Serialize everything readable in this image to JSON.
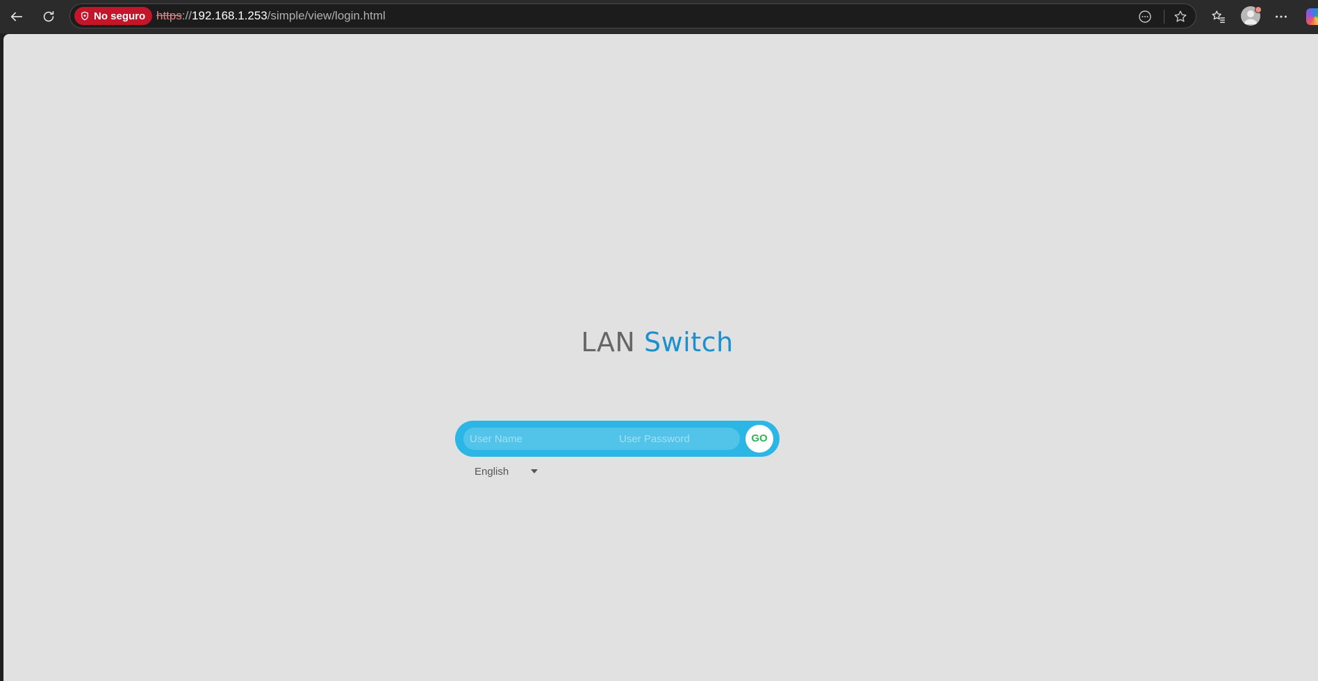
{
  "browser": {
    "security_label": "No seguro",
    "url": {
      "scheme": "https",
      "separator": "://",
      "host": "192.168.1.253",
      "path": "/simple/view/login.html"
    },
    "icons": {
      "back": "back-arrow-icon",
      "refresh": "refresh-icon",
      "security": "shield-warning-icon",
      "page_options": "more-circle-icon",
      "favorite": "star-icon",
      "favorites_list": "favorites-icon",
      "profile": "profile-avatar-icon",
      "menu": "ellipsis-icon",
      "copilot": "copilot-icon"
    },
    "colors": {
      "security_badge": "#c4152a",
      "toolbar": "#2b2b2b"
    }
  },
  "page": {
    "title_part1": "LAN",
    "title_part2": "Switch",
    "username_placeholder": "User Name",
    "password_placeholder": "User Password",
    "go_label": "GO",
    "language_selected": "English",
    "colors": {
      "background": "#e1e1e1",
      "login_box": "#2cb6e6",
      "title_accent": "#1e8fcd",
      "go_text": "#2fb25a"
    }
  }
}
